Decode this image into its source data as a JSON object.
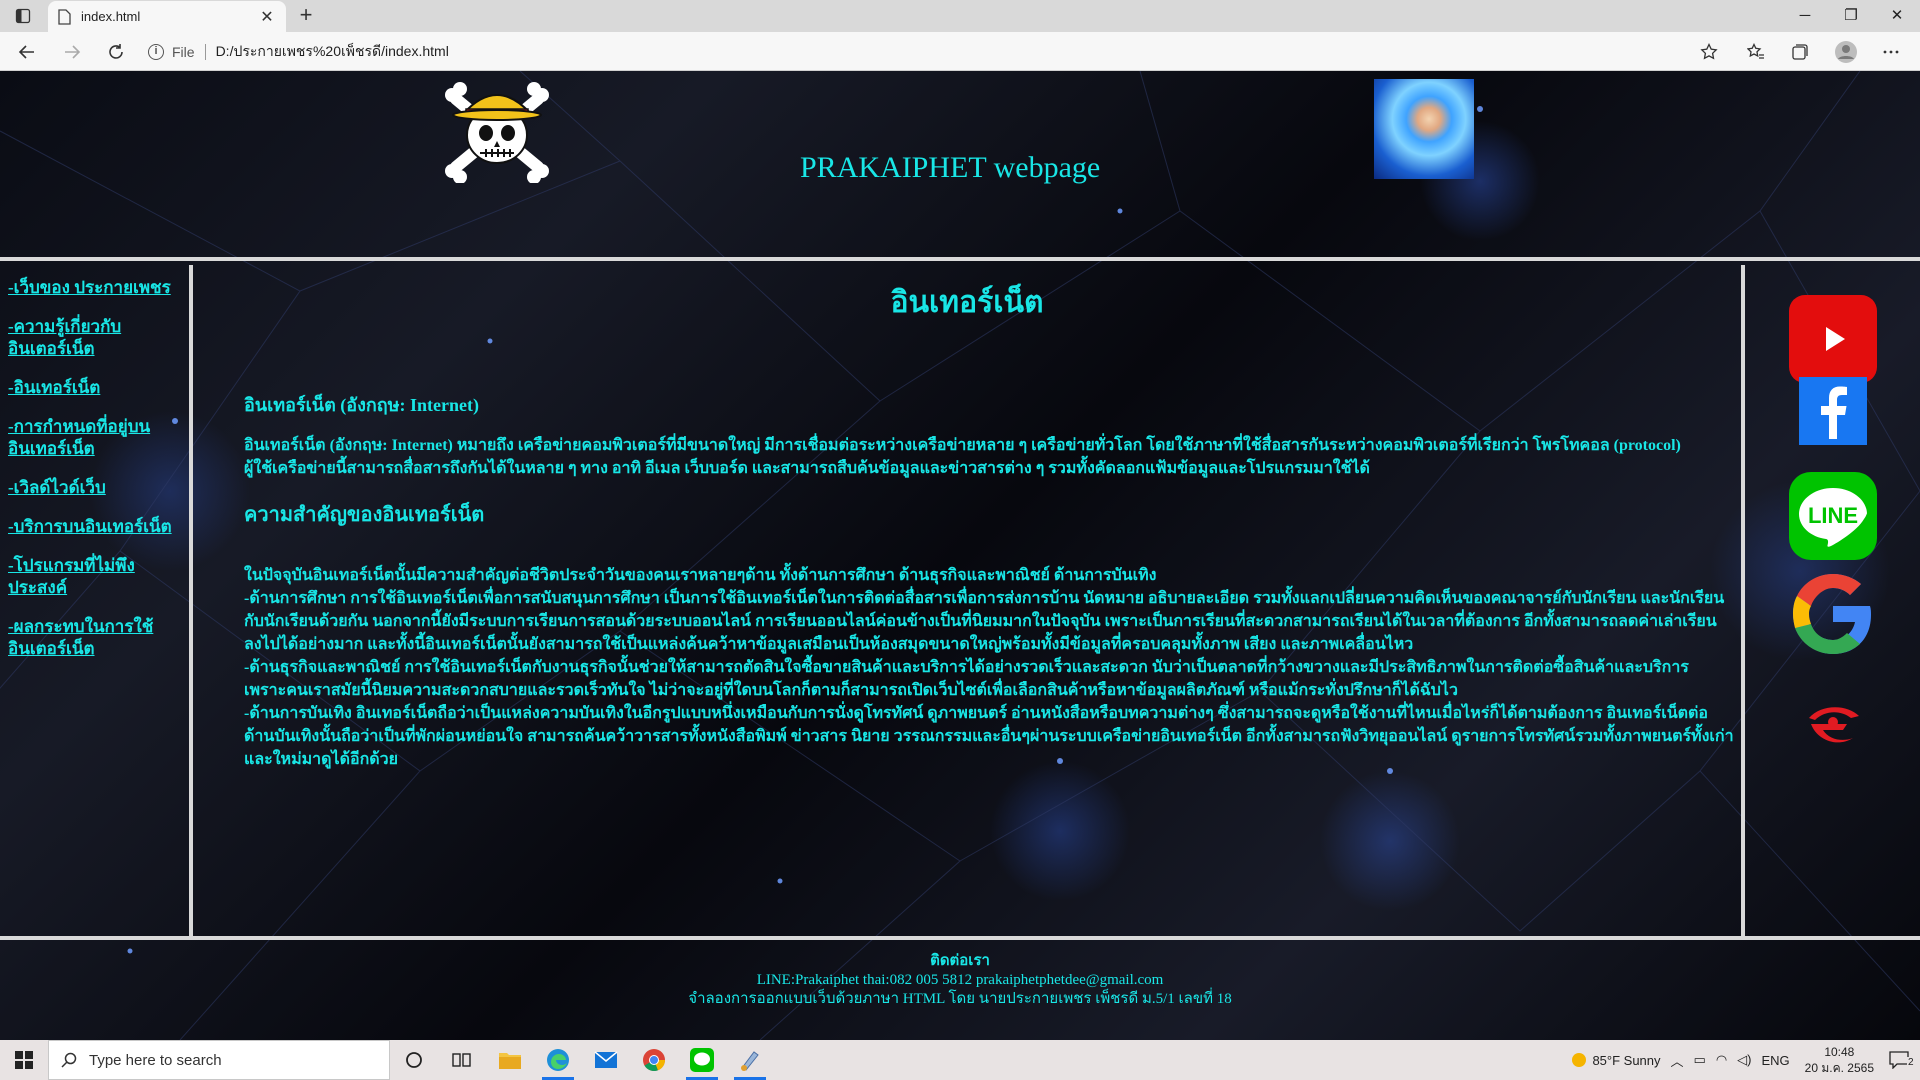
{
  "browser": {
    "tab_title": "index.html",
    "tab_close": "✕",
    "new_tab": "+",
    "minimize": "─",
    "restore": "❐",
    "close": "✕",
    "address_scheme": "File",
    "address_url": "D:/ประกายเพชร%20เพ็ชรดี/index.html"
  },
  "header": {
    "site_title": "PRAKAIPHET webpage"
  },
  "sidebar": {
    "items": [
      {
        "label": "-เว็บของ ประกายเพชร"
      },
      {
        "label": "-ความรู้เกี่ยวกับ อินเตอร์เน็ต"
      },
      {
        "label": "-อินเทอร์เน็ต"
      },
      {
        "label": "-การกำหนดที่อยู่บน อินเทอร์เน็ต"
      },
      {
        "label": "-เวิลด์ไวด์เว็บ"
      },
      {
        "label": "-บริการบนอินเทอร์เน็ต"
      },
      {
        "label": "-โปรแกรมที่ไม่พึง ประสงค์"
      },
      {
        "label": "-ผลกระทบในการใช้ อินเตอร์เน็ต"
      }
    ]
  },
  "main": {
    "heading": "อินเทอร์เน็ต",
    "intro_heading": "อินเทอร์เน็ต (อังกฤษ: Internet)",
    "intro_text": "อินเทอร์เน็ต (อังกฤษ: Internet) หมายถึง เครือข่ายคอมพิวเตอร์ที่มีขนาดใหญ่ มีการเชื่อมต่อระหว่างเครือข่ายหลาย ๆ เครือข่ายทั่วโลก โดยใช้ภาษาที่ใช้สื่อสารกันระหว่างคอมพิวเตอร์ที่เรียกว่า โพรโทคอล (protocol) ผู้ใช้เครือข่ายนี้สามารถสื่อสารถึงกันได้ในหลาย ๆ ทาง อาทิ อีเมล เว็บบอร์ด และสามารถสืบค้นข้อมูลและข่าวสารต่าง ๆ รวมทั้งคัดลอกแฟ้มข้อมูลและโปรแกรมมาใช้ได้",
    "importance_heading": "ความสำคัญของอินเทอร์เน็ต",
    "importance_lines": [
      "ในปัจจุบันอินเทอร์เน็ตนั้นมีความสำคัญต่อชีวิตประจำวันของคนเราหลายๆด้าน ทั้งด้านการศึกษา ด้านธุรกิจและพาณิชย์ ด้านการบันเทิง",
      "-ด้านการศึกษา การใช้อินเทอร์เน็ตเพื่อการสนับสนุนการศึกษา เป็นการใช้อินเทอร์เน็ตในการติดต่อสื่อสารเพื่อการส่งการบ้าน นัดหมาย อธิบายละเอียด รวมทั้งแลกเปลี่ยนความคิดเห็นของคณาจารย์กับนักเรียน และนักเรียนกับนักเรียนด้วยกัน นอกจากนี้ยังมีระบบการเรียนการสอนด้วยระบบออนไลน์ การเรียนออนไลน์ค่อนข้างเป็นที่นิยมมากในปัจจุบัน เพราะเป็นการเรียนที่สะดวกสามารถเรียนได้ในเวลาที่ต้องการ อีกทั้งสามารถลดค่าเล่าเรียนลงไปได้อย่างมาก และทั้งนี้อินเทอร์เน็ตนั้นยังสามารถใช้เป็นแหล่งค้นคว้าหาข้อมูลเสมือนเป็นห้องสมุดขนาดใหญ่พร้อมทั้งมีข้อมูลที่ครอบคลุมทั้งภาพ เสียง และภาพเคลื่อนไหว",
      "-ด้านธุรกิจและพาณิชย์ การใช้อินเทอร์เน็ตกับงานธุรกิจนั้นช่วยให้สามารถตัดสินใจซื้อขายสินค้าและบริการได้อย่างรวดเร็วและสะดวก นับว่าเป็นตลาดที่กว้างขวางและมีประสิทธิภาพในการติดต่อซื้อสินค้าและบริการ เพราะคนเราสมัยนี้นิยมความสะดวกสบายและรวดเร็วทันใจ ไม่ว่าจะอยู่ที่ใดบนโลกก็ตามก็สามารถเปิดเว็บไซต์เพื่อเลือกสินค้าหรือหาข้อมูลผลิตภัณฑ์ หรือแม้กระทั่งปรึกษาก็ได้ฉับไว",
      "-ด้านการบันเทิง อินเทอร์เน็ตถือว่าเป็นแหล่งความบันเทิงในอีกรูปแบบหนึ่งเหมือนกับการนั่งดูโทรทัศน์ ดูภาพยนตร์ อ่านหนังสือหรือบทความต่างๆ ซึ่งสามารถจะดูหรือใช้งานที่ไหนเมื่อไหร่ก็ได้ตามต้องการ อินเทอร์เน็ตต่อด้านบันเทิงนั้นถือว่าเป็นที่พักผ่อนหย่อนใจ สามารถค้นคว้าวารสารทั้งหนังสือพิมพ์ ข่าวสาร นิยาย วรรณกรรมและอื่นๆผ่านระบบเครือข่ายอินเทอร์เน็ต อีกทั้งสามารถฟังวิทยุออนไลน์ ดูรายการโทรทัศน์รวมทั้งภาพยนตร์ทั้งเก่าและใหม่มาดูได้อีกด้วย"
    ]
  },
  "social": {
    "line_label": "LINE"
  },
  "footer": {
    "title": "ติดต่อเรา",
    "contact": "LINE:Prakaiphet thai:082 005 5812 prakaiphetphetdee@gmail.com",
    "credit": "จำลองการออกแบบเว็บด้วยภาษา HTML โดย นายประกายเพชร เพ็ชรดี ม.5/1 เลขที่ 18"
  },
  "taskbar": {
    "search_placeholder": "Type here to search",
    "weather": "85°F  Sunny",
    "language": "ENG",
    "time": "10:48",
    "date": "20 ม.ค. 2565",
    "notification_count": "2"
  },
  "colors": {
    "accent_text": "#19e6e6",
    "panel_border": "#d9d9d9"
  }
}
